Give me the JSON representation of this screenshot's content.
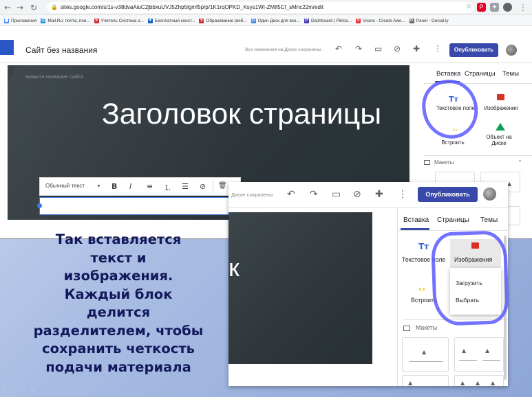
{
  "browser": {
    "nav": {
      "back": "←",
      "forward": "→",
      "reload": "↻"
    },
    "url_host": "sites.google.com",
    "url_path": "/s/1s-v38dvaAiuC2jbbxuUVJ5Zhp5lgmf5p/p/1K1rqOPKD_Ksys1WI-ZMif5Cf_sMnc22m/edit",
    "star": "☆",
    "menu": "⋮",
    "bookmarks": [
      {
        "label": "Приложения",
        "color": "#4285f4",
        "glyph": "▦"
      },
      {
        "label": "Mail.Ru: почта, пои...",
        "color": "#168de2",
        "glyph": "@"
      },
      {
        "label": "Учитель Система э...",
        "color": "#d32f2f",
        "glyph": "5"
      },
      {
        "label": "Бесплатный конст...",
        "color": "#1565c0",
        "glyph": "✈"
      },
      {
        "label": "Образование (веб...",
        "color": "#d32f2f",
        "glyph": "5"
      },
      {
        "label": "Один Диск для все...",
        "color": "#4285f4",
        "glyph": "G"
      },
      {
        "label": "Dashboard | Piktoc...",
        "color": "#4a3ab5",
        "glyph": "P"
      },
      {
        "label": "Visme - Create Awe...",
        "color": "#e53935",
        "glyph": "V"
      },
      {
        "label": "Panel - Genial.ly",
        "color": "#666666",
        "glyph": "G"
      }
    ]
  },
  "editor_top": {
    "doc_title": "Сайт без названия",
    "saved_note": "Все изменения на Диске сохранены",
    "publish_label": "Опубликовать",
    "icons": {
      "undo": "↶",
      "redo": "↷",
      "preview": "▭",
      "link": "⊘",
      "share": "✚",
      "more": "⋮"
    }
  },
  "canvas": {
    "site_name_placeholder": "Укажите название сайта",
    "page_heading": "Заголовок страницы"
  },
  "insert_panel_top": {
    "tabs": [
      "Вставка",
      "Страницы",
      "Темы"
    ],
    "text_icon": "Tт",
    "text_label": "Текстовое поле",
    "images_label": "Изображения",
    "embed_icon": "‹›",
    "embed_label": "Встроить",
    "drive_label": "Объект на Диске",
    "layouts_label": "Макеты"
  },
  "text_toolbar": {
    "style_label": "Обычный текст",
    "bold": "B",
    "italic": "I",
    "align": "≡",
    "numbered": "⒈",
    "bulleted": "☰",
    "link": "⊘",
    "delete": "🗑"
  },
  "zoomed": {
    "saved_note": "Диске сохранены",
    "publish_label": "Опубликовать",
    "canvas_fragment": "к",
    "tabs": [
      "Вставка",
      "Страницы",
      "Темы"
    ],
    "text_icon": "Tт",
    "text_label": "Текстовое поле",
    "images_label": "Изображения",
    "embed_icon": "‹›",
    "embed_label": "Встроить",
    "dropdown": [
      "Загрузить",
      "Выбрать"
    ],
    "layouts_label": "Макеты"
  },
  "caption": [
    "Так вставляется",
    "текст  и",
    "изображения.",
    "Каждый блок",
    "делится",
    "разделителем, чтобы",
    "сохранить четкость",
    "подачи материала"
  ],
  "slide_controls": "◂ ◸ ▭ ▸",
  "colors": {
    "accent": "#3949ab",
    "highlight_ring": "#5a5aff",
    "caption": "#13195c",
    "canvas_dark": "#2e363b"
  }
}
